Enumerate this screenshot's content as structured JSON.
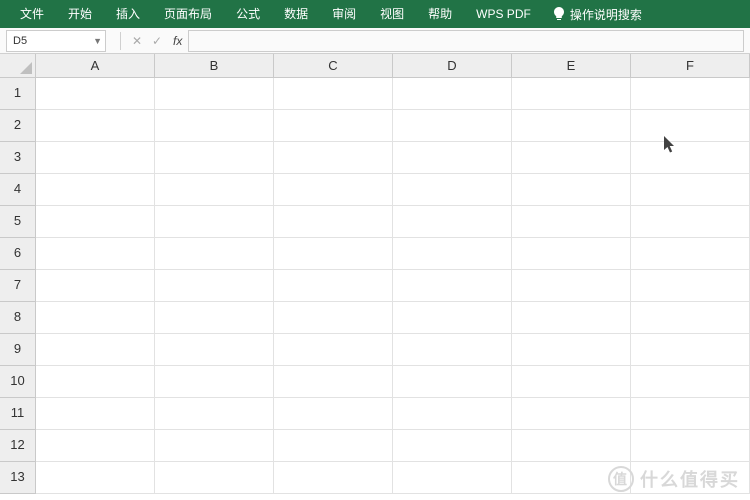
{
  "ribbon": {
    "tabs": [
      "文件",
      "开始",
      "插入",
      "页面布局",
      "公式",
      "数据",
      "审阅",
      "视图",
      "帮助",
      "WPS PDF"
    ],
    "help_search": "操作说明搜索"
  },
  "formula_bar": {
    "cell_ref": "D5",
    "fx_label": "fx",
    "formula_value": ""
  },
  "grid": {
    "columns": [
      "A",
      "B",
      "C",
      "D",
      "E",
      "F"
    ],
    "rows": [
      "1",
      "2",
      "3",
      "4",
      "5",
      "6",
      "7",
      "8",
      "9",
      "10",
      "11",
      "12",
      "13"
    ]
  },
  "watermark": {
    "icon": "值",
    "text": "什么值得买"
  }
}
